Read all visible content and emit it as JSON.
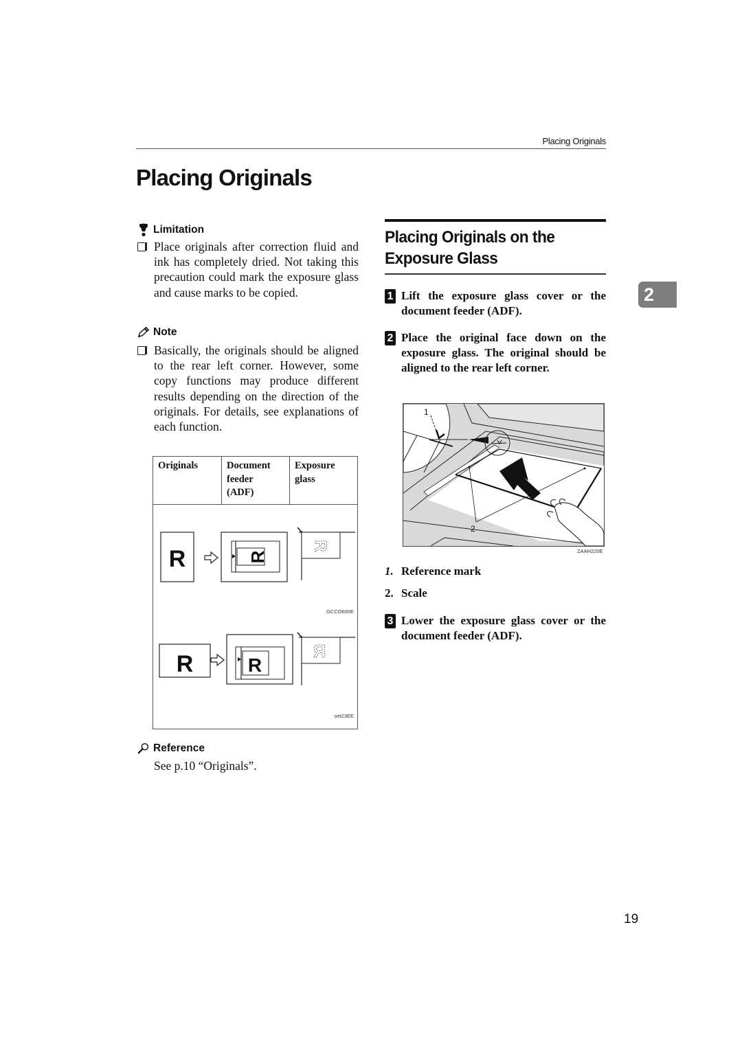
{
  "running_header": "Placing Originals",
  "page_title": "Placing Originals",
  "left_column": {
    "limitation": {
      "heading": "Limitation",
      "icon": "limitation-icon",
      "items": [
        "Place originals after correction fluid and ink has completely dried. Not taking this precaution could mark the exposure glass and cause marks to be copied."
      ]
    },
    "note": {
      "heading": "Note",
      "icon": "pencil-icon",
      "items": [
        "Basically, the originals should be aligned to the rear left corner. However, some copy functions may produce different results depending on the direction of the originals. For details, see explanations of each function."
      ]
    },
    "orientation_table": {
      "headers": [
        "Originals",
        "Document feeder (ADF)",
        "Exposure glass"
      ],
      "header_lines": [
        [
          "Originals"
        ],
        [
          "Document",
          "feeder",
          "(ADF)"
        ],
        [
          "Exposure",
          "glass"
        ]
      ],
      "rows": [
        {
          "original": "R",
          "orientation": "portrait",
          "figure_code": "GCCO600E"
        },
        {
          "original": "R",
          "orientation": "landscape",
          "figure_code": "set23EE"
        }
      ]
    },
    "reference": {
      "heading": "Reference",
      "icon": "magnifier-icon",
      "text": "See p.10 “Originals”."
    }
  },
  "right_column": {
    "section_title_lines": [
      "Placing Originals on the",
      "Exposure Glass"
    ],
    "steps": [
      {
        "number": "1",
        "text": "Lift the exposure glass cover or the document feeder (ADF)."
      },
      {
        "number": "2",
        "text": "Place the original face down on the exposure glass. The original should be aligned to the rear left corner."
      },
      {
        "number": "3",
        "text": "Lower the exposure glass cover or the document feeder (ADF)."
      }
    ],
    "figure": {
      "callouts": [
        "1",
        "2"
      ],
      "code": "ZAAH220E"
    },
    "legend": [
      {
        "number": "1.",
        "label": "Reference mark"
      },
      {
        "number": "2.",
        "label": "Scale"
      }
    ]
  },
  "chapter_tab": "2",
  "page_number": "19"
}
